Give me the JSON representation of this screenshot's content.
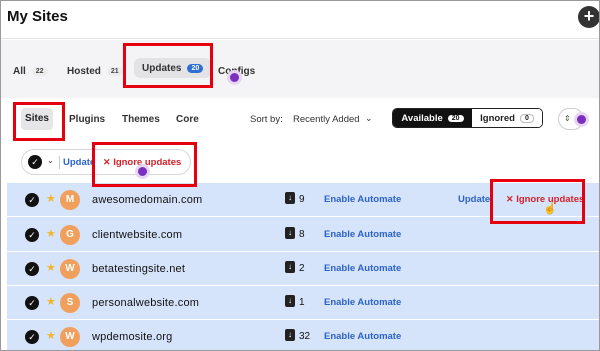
{
  "header": {
    "title": "My Sites",
    "add_icon": "plus-icon"
  },
  "top_tabs": [
    {
      "label": "All",
      "count": "22"
    },
    {
      "label": "Hosted",
      "count": "21"
    },
    {
      "label": "Updates",
      "count": "20"
    },
    {
      "label": "Configs"
    }
  ],
  "filter_tabs": [
    "Sites",
    "Plugins",
    "Themes",
    "Core"
  ],
  "sort": {
    "label": "Sort by:",
    "value": "Recently Added",
    "chevron": "chevron-down-icon"
  },
  "status_toggle": {
    "available_label": "Available",
    "available_count": "20",
    "ignored_label": "Ignored",
    "ignored_count": "0"
  },
  "bulk": {
    "update_label": "Update",
    "ignore_label": "Ignore updates"
  },
  "rows": [
    {
      "initial": "M",
      "domain": "awesomedomain.com",
      "updates": "9",
      "automate": "Enable Automate",
      "update": "Update",
      "ignore": "Ignore updates"
    },
    {
      "initial": "G",
      "domain": "clientwebsite.com",
      "updates": "8",
      "automate": "Enable Automate"
    },
    {
      "initial": "W",
      "domain": "betatestingsite.net",
      "updates": "2",
      "automate": "Enable Automate"
    },
    {
      "initial": "S",
      "domain": "personalwebsite.com",
      "updates": "1",
      "automate": "Enable Automate"
    },
    {
      "initial": "W",
      "domain": "wpdemosite.org",
      "updates": "32",
      "automate": "Enable Automate"
    }
  ],
  "colors": {
    "accent_blue": "#2c63c6",
    "danger_red": "#d3222a",
    "highlight_red": "#e6000f",
    "avatar_orange": "#f0a05c",
    "row_bg": "#d6e4fb",
    "purple_dot": "#7b2fbf"
  }
}
